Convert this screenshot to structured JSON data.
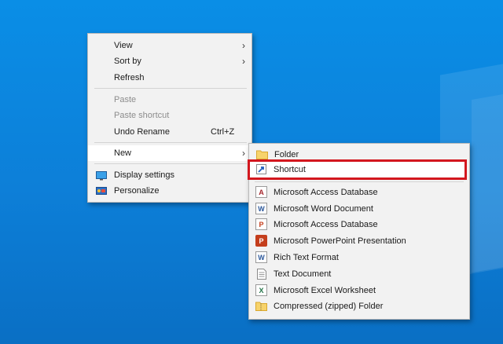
{
  "context_menu": {
    "items": [
      {
        "label": "View",
        "has_submenu": true
      },
      {
        "label": "Sort by",
        "has_submenu": true
      },
      {
        "label": "Refresh"
      },
      {
        "label": "Paste",
        "disabled": true
      },
      {
        "label": "Paste shortcut",
        "disabled": true
      },
      {
        "label": "Undo Rename",
        "shortcut": "Ctrl+Z"
      },
      {
        "label": "New",
        "has_submenu": true,
        "hovered": true
      },
      {
        "label": "Display settings",
        "icon": "display-icon"
      },
      {
        "label": "Personalize",
        "icon": "personalize-icon"
      }
    ]
  },
  "new_submenu": {
    "items": [
      {
        "label": "Folder",
        "icon": "folder-icon"
      },
      {
        "label": "Shortcut",
        "icon": "shortcut-icon",
        "highlighted": true
      },
      {
        "label": "Microsoft Access Database",
        "icon": "access-icon"
      },
      {
        "label": "Microsoft Word Document",
        "icon": "word-icon"
      },
      {
        "label": "Microsoft Access Database",
        "icon": "access-icon"
      },
      {
        "label": "Microsoft PowerPoint Presentation",
        "icon": "powerpoint-icon"
      },
      {
        "label": "Rich Text Format",
        "icon": "rtf-icon"
      },
      {
        "label": "Text Document",
        "icon": "text-document-icon"
      },
      {
        "label": "Microsoft Excel Worksheet",
        "icon": "excel-icon"
      },
      {
        "label": "Compressed (zipped) Folder",
        "icon": "zip-folder-icon"
      }
    ]
  },
  "colors": {
    "desktop": "#0a8ee6",
    "menu_background": "#f2f2f2",
    "highlight_border": "#d3171e"
  }
}
